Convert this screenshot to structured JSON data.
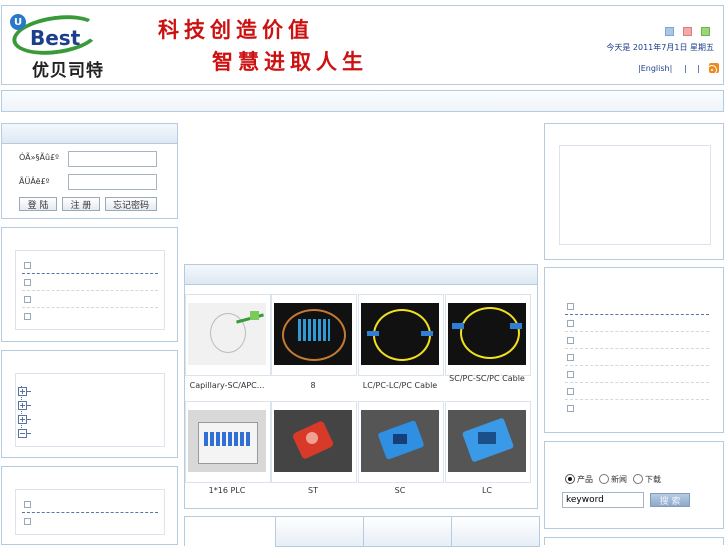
{
  "header": {
    "logo_mark": "Best",
    "logo_cn": "优贝司特",
    "slogan_line1": "科技创造价值",
    "slogan_line2": "智慧进取人生",
    "date_text": "今天是 2011年7月1日 星期五",
    "lang_link": "|English|",
    "sep1": "|",
    "sep2": "|",
    "colors": {
      "swatch1": "#a9c7e8",
      "swatch2": "#f3a9a9",
      "swatch3": "#9bd67b",
      "brand_green": "#3a9a3a",
      "brand_blue": "#1c3f8c",
      "slogan_red": "#cc1111"
    }
  },
  "login": {
    "user_label": "ÓÃ»§Ãû£º",
    "pass_label": "ÃÜÂë£º",
    "user_value": "",
    "pass_value": "",
    "login_button": "登 陆",
    "register_button": "注 册",
    "forgot_button": "忘记密码"
  },
  "products": [
    {
      "caption": "Capillary-SC/APC..."
    },
    {
      "caption": "8"
    },
    {
      "caption": "LC/PC-LC/PC Cable"
    },
    {
      "caption": "SC/PC-SC/PC Cable"
    },
    {
      "caption": "1*16 PLC"
    },
    {
      "caption": "ST"
    },
    {
      "caption": "SC"
    },
    {
      "caption": "LC"
    }
  ],
  "search": {
    "radio1": "产品",
    "radio2": "新闻",
    "radio3": "下载",
    "input_value": "keyword",
    "search_button": "搜 索"
  }
}
